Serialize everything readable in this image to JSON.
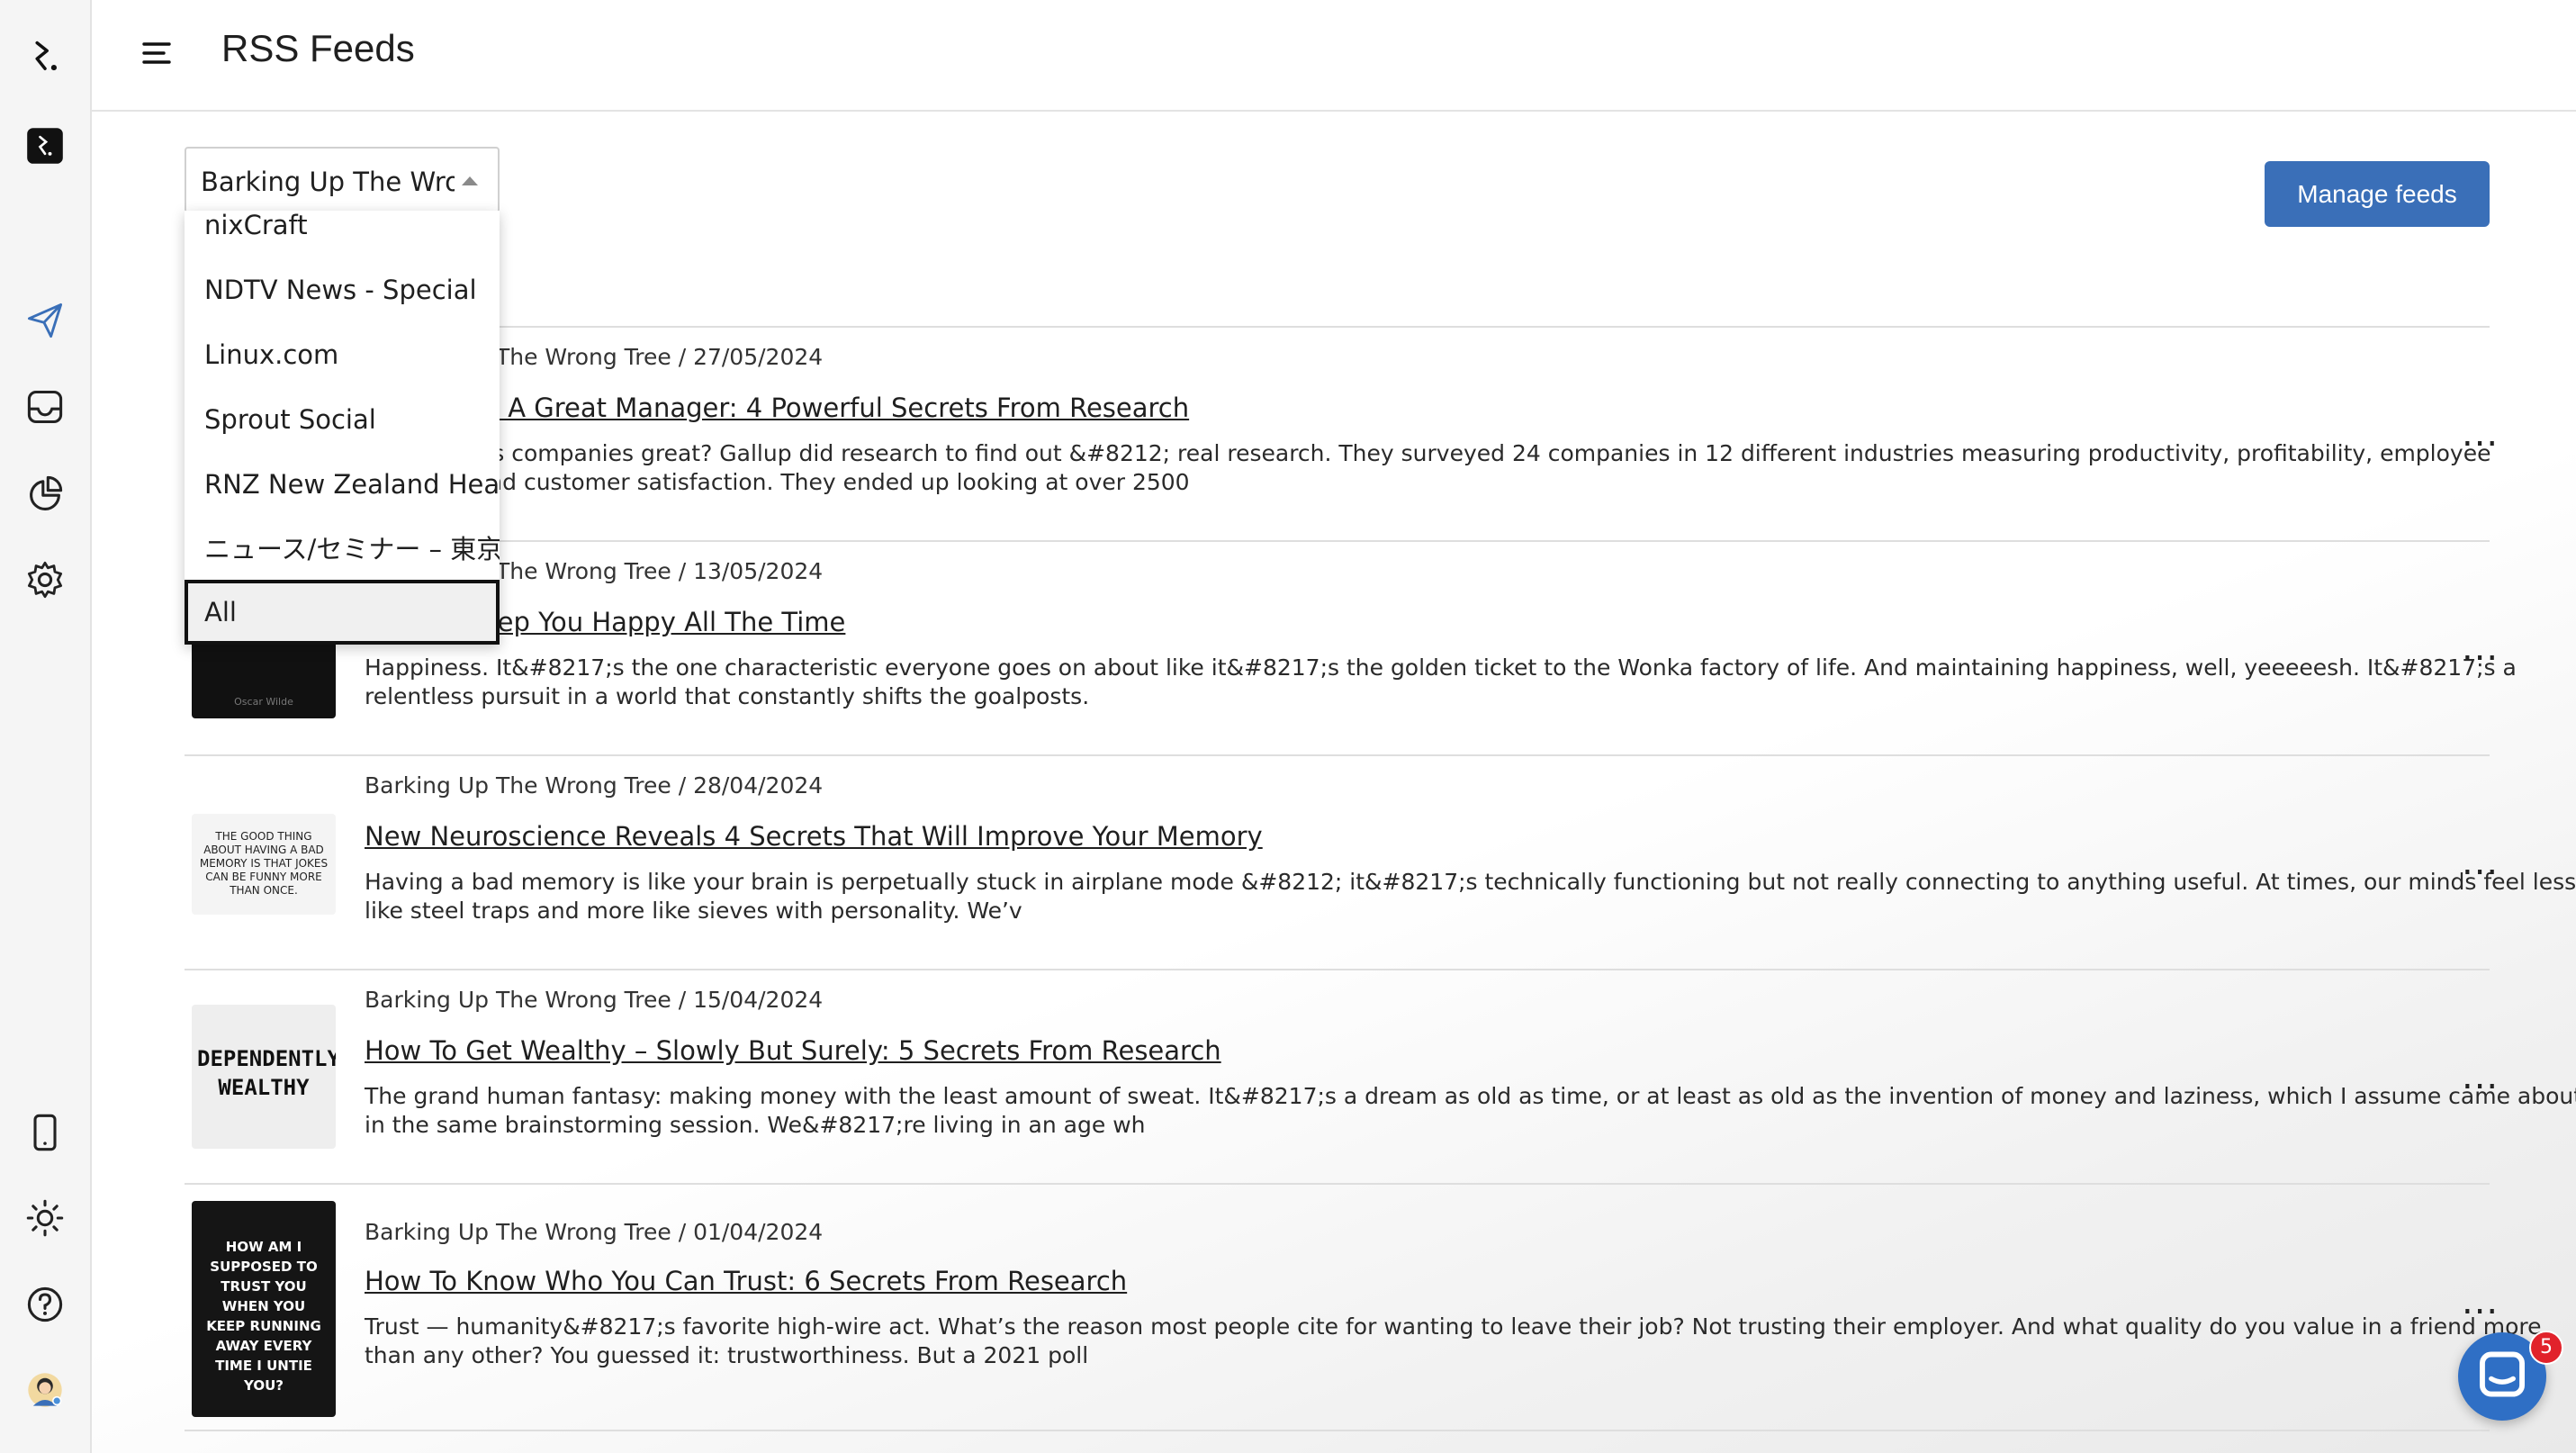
{
  "app": {
    "title": "RSS Feeds"
  },
  "sidebar": {
    "icons": [
      "logo-icon",
      "terminal-icon",
      "send-icon",
      "inbox-icon",
      "analytics-icon",
      "settings-icon",
      "mobile-icon",
      "sun-icon",
      "help-icon",
      "user-avatar"
    ]
  },
  "filter": {
    "selected": "Barking Up The Wrong Tree",
    "options": [
      "nixCraft",
      "NDTV News - Special",
      "Linux.com",
      "Sprout Social",
      "RNZ New Zealand Headlines",
      "ニュース/セミナー – 東京",
      "All"
    ],
    "highlighted": "All"
  },
  "manage_button": "Manage feeds",
  "feed": [
    {
      "meta": "Barking Up The Wrong Tree / 27/05/2024",
      "title": "How To Be A Great Manager: 4 Powerful Secrets From Research",
      "desc": "What makes companies great? Gallup did research to find out &#8212; real research. They surveyed 24 companies in 12 different industries measuring productivity, profitability, employee retention and customer satisfaction. They ended up looking at over 2500",
      "thumb_text": ""
    },
    {
      "meta": "Barking Up The Wrong Tree / 13/05/2024",
      "title": "How To Keep You Happy All The Time",
      "desc": "Happiness. It&#8217;s the one characteristic everyone goes on about like it&#8217;s the golden ticket to the Wonka factory of life. And maintaining happiness, well, yeeeeesh. It&#8217;s a relentless pursuit in a world that constantly shifts the goalposts.",
      "thumb_text": "Oscar Wilde"
    },
    {
      "meta": "Barking Up The Wrong Tree / 28/04/2024",
      "title": "New Neuroscience Reveals 4 Secrets That Will Improve Your Memory",
      "desc": "Having a bad memory is like your brain is perpetually stuck in airplane mode &#8212; it&#8217;s technically functioning but not really connecting to anything useful. At times, our minds feel less like steel traps and more like sieves with personality. We’v",
      "thumb_text": "THE GOOD THING ABOUT HAVING A BAD MEMORY IS THAT JOKES CAN BE FUNNY MORE THAN ONCE."
    },
    {
      "meta": "Barking Up The Wrong Tree / 15/04/2024",
      "title": "How To Get Wealthy – Slowly But Surely: 5 Secrets From Research",
      "desc": "The grand human fantasy: making money with the least amount of sweat. It&#8217;s a dream as old as time, or at least as old as the invention of money and laziness, which I assume came about in the same brainstorming session. We&#8217;re living in an age wh",
      "thumb_text": "DEPENDENTLY WEALTHY"
    },
    {
      "meta": "Barking Up The Wrong Tree / 01/04/2024",
      "title": "How To Know Who You Can Trust: 6 Secrets From Research",
      "desc": "Trust — humanity&#8217;s favorite high-wire act. What’s the reason most people cite for wanting to leave their job? Not trusting their employer. And what quality do you value in a friend more than any other? You guessed it: trustworthiness. But a 2021 poll",
      "thumb_text": "HOW AM I SUPPOSED TO TRUST YOU WHEN YOU KEEP RUNNING AWAY EVERY TIME I UNTIE YOU?"
    }
  ],
  "more_icon": "...",
  "chat": {
    "badge": "5"
  },
  "colors": {
    "accent": "#3a6fb8",
    "badge": "#e1222b",
    "sidebar_icon": "#3a6fb8"
  }
}
